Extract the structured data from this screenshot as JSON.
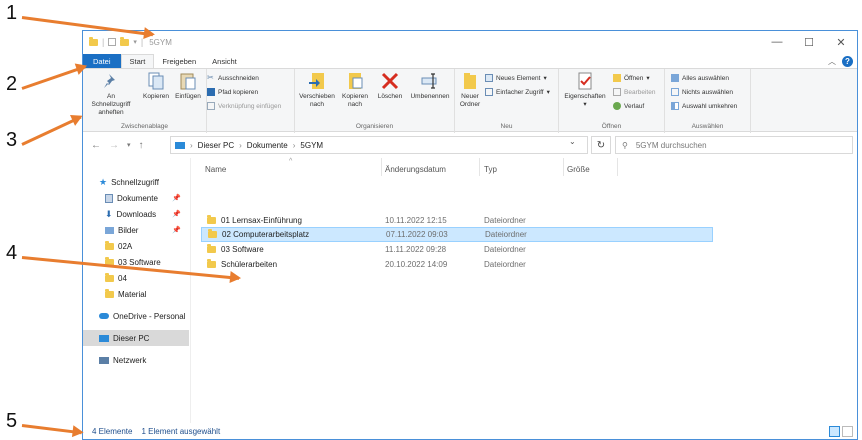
{
  "annotations": [
    "1",
    "2",
    "3",
    "4",
    "5"
  ],
  "window": {
    "title": "5GYM",
    "controls": {
      "minimize": "—",
      "maximize": "☐",
      "close": "✕"
    }
  },
  "tabs": {
    "file": "Datei",
    "start": "Start",
    "share": "Freigeben",
    "view": "Ansicht"
  },
  "ribbon": {
    "clipboard": {
      "pin_quick": "An Schnellzugriff anheften",
      "copy": "Kopieren",
      "paste": "Einfügen",
      "cut": "Ausschneiden",
      "copy_path": "Pfad kopieren",
      "paste_shortcut": "Verknüpfung einfügen",
      "label": "Zwischenablage"
    },
    "organize": {
      "move_to": "Verschieben nach",
      "copy_to": "Kopieren nach",
      "delete": "Löschen",
      "rename": "Umbenennen",
      "label": "Organisieren"
    },
    "new": {
      "new_folder": "Neuer Ordner",
      "new_item": "Neues Element",
      "easy_access": "Einfacher Zugriff",
      "label": "Neu"
    },
    "open": {
      "properties": "Eigenschaften",
      "open": "Öffnen",
      "edit": "Bearbeiten",
      "history": "Verlauf",
      "label": "Öffnen"
    },
    "select": {
      "select_all": "Alles auswählen",
      "select_none": "Nichts auswählen",
      "invert": "Auswahl umkehren",
      "label": "Auswählen"
    }
  },
  "address": {
    "crumbs": [
      "Dieser PC",
      "Dokumente",
      "5GYM"
    ],
    "search_placeholder": "5GYM durchsuchen"
  },
  "sidebar": {
    "items": [
      {
        "label": "Schnellzugriff",
        "icon": "star-icon"
      },
      {
        "label": "Dokumente",
        "icon": "documents-icon",
        "pinned": true
      },
      {
        "label": "Downloads",
        "icon": "download-icon",
        "pinned": true
      },
      {
        "label": "Bilder",
        "icon": "pictures-icon",
        "pinned": true
      },
      {
        "label": "02A",
        "icon": "folder-icon"
      },
      {
        "label": "03 Software",
        "icon": "folder-icon"
      },
      {
        "label": "04",
        "icon": "folder-icon"
      },
      {
        "label": "Material",
        "icon": "folder-icon"
      },
      {
        "label": "OneDrive - Personal",
        "icon": "cloud-icon"
      },
      {
        "label": "Dieser PC",
        "icon": "pc-icon"
      },
      {
        "label": "Netzwerk",
        "icon": "network-icon"
      }
    ]
  },
  "columns": {
    "name": "Name",
    "date": "Änderungsdatum",
    "type": "Typ",
    "size": "Größe"
  },
  "files": [
    {
      "name": "01 Lernsax-Einführung",
      "date": "10.11.2022 12:15",
      "type": "Dateiordner"
    },
    {
      "name": "02 Computerarbeitsplatz",
      "date": "07.11.2022 09:03",
      "type": "Dateiordner"
    },
    {
      "name": "03 Software",
      "date": "11.11.2022 09:28",
      "type": "Dateiordner"
    },
    {
      "name": "Schülerarbeiten",
      "date": "20.10.2022 14:09",
      "type": "Dateiordner"
    }
  ],
  "status": {
    "count": "4 Elemente",
    "selected": "1 Element ausgewählt"
  },
  "colors": {
    "accent": "#1a6fc4",
    "selection": "#cce8ff",
    "arrow": "#e87d2f",
    "folder": "#f2c94c"
  }
}
